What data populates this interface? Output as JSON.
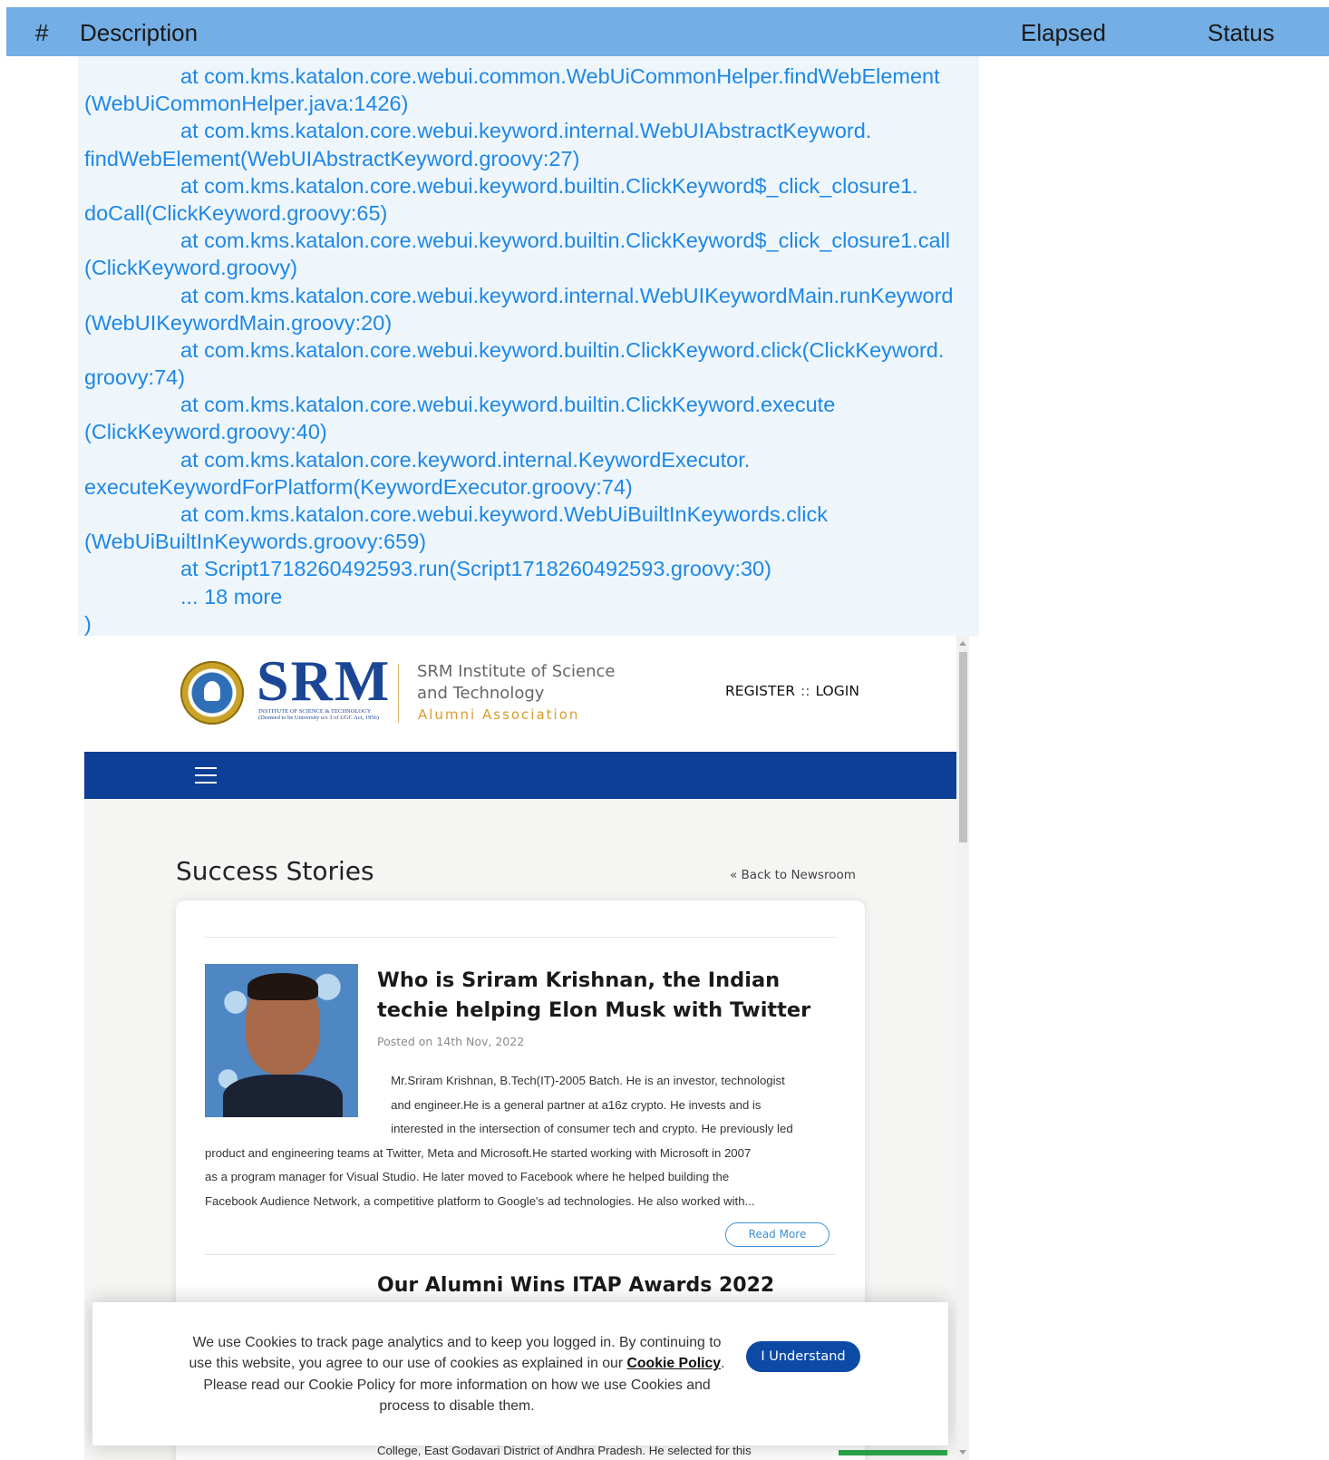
{
  "report": {
    "columns": {
      "num": "#",
      "description": "Description",
      "elapsed": "Elapsed",
      "status": "Status"
    },
    "header_color": "#73aee4",
    "log_text_color": "#1e87e6"
  },
  "log": {
    "lines": [
      {
        "indent": true,
        "text": "at com.kms.katalon.core.webui.common.WebUiCommonHelper.findWebElement"
      },
      {
        "indent": false,
        "text": "(WebUiCommonHelper.java:1426)"
      },
      {
        "indent": true,
        "text": "at com.kms.katalon.core.webui.keyword.internal.WebUIAbstractKeyword."
      },
      {
        "indent": false,
        "text": "findWebElement(WebUIAbstractKeyword.groovy:27)"
      },
      {
        "indent": true,
        "text": "at com.kms.katalon.core.webui.keyword.builtin.ClickKeyword$_click_closure1."
      },
      {
        "indent": false,
        "text": "doCall(ClickKeyword.groovy:65)"
      },
      {
        "indent": true,
        "text": "at com.kms.katalon.core.webui.keyword.builtin.ClickKeyword$_click_closure1.call"
      },
      {
        "indent": false,
        "text": "(ClickKeyword.groovy)"
      },
      {
        "indent": true,
        "text": "at com.kms.katalon.core.webui.keyword.internal.WebUIKeywordMain.runKeyword"
      },
      {
        "indent": false,
        "text": "(WebUIKeywordMain.groovy:20)"
      },
      {
        "indent": true,
        "text": "at com.kms.katalon.core.webui.keyword.builtin.ClickKeyword.click(ClickKeyword."
      },
      {
        "indent": false,
        "text": "groovy:74)"
      },
      {
        "indent": true,
        "text": "at com.kms.katalon.core.webui.keyword.builtin.ClickKeyword.execute"
      },
      {
        "indent": false,
        "text": "(ClickKeyword.groovy:40)"
      },
      {
        "indent": true,
        "text": "at com.kms.katalon.core.keyword.internal.KeywordExecutor."
      },
      {
        "indent": false,
        "text": "executeKeywordForPlatform(KeywordExecutor.groovy:74)"
      },
      {
        "indent": true,
        "text": "at com.kms.katalon.core.webui.keyword.WebUiBuiltInKeywords.click"
      },
      {
        "indent": false,
        "text": "(WebUiBuiltInKeywords.groovy:659)"
      },
      {
        "indent": true,
        "text": "at Script1718260492593.run(Script1718260492593.groovy:30)"
      },
      {
        "indent": true,
        "text": "... 18 more"
      },
      {
        "indent": false,
        "text": ")"
      }
    ]
  },
  "site": {
    "logo_text": "SRM",
    "logo_subtext": "INSTITUTE OF SCIENCE & TECHNOLOGY (Deemed to be University u/s 3 of UGC Act, 1956)",
    "institute_name": "SRM Institute of Science and Technology",
    "alumni_label": "Alumni Association",
    "register": "REGISTER",
    "separator": "::",
    "login": "LOGIN",
    "nav_color": "#0e3f96",
    "page_title": "Success Stories",
    "back_link": "« Back to Newsroom",
    "story": {
      "title": "Who is Sriram Krishnan, the Indian techie helping Elon Musk with Twitter",
      "posted": "Posted on 14th Nov, 2022",
      "excerpt_lines": [
        "                                                        Mr.Sriram Krishnan, B.Tech(IT)-2005 Batch. He is an investor, technologist",
        "                                                        and engineer.He is a general partner at a16z crypto. He invests and is",
        "                                                        interested in the intersection of consumer tech and crypto. He previously led",
        "product and engineering teams at Twitter, Meta and Microsoft.He started working with Microsoft in 2007",
        "as a program manager for Visual Studio. He later moved to Facebook where he helped building the",
        "Facebook Audience Network, a competitive platform to Google's ad technologies. He also worked with..."
      ],
      "read_more": "Read More"
    },
    "next_story_title_partial": "Our Alumni Wins ITAP Awards 2022",
    "bottom_text": "College, East Godavari District of Andhra Pradesh. He selected for this",
    "cookie": {
      "text_before": "We use Cookies to track page analytics and to keep you logged in. By continuing to use this website, you agree to our use of cookies as explained in our ",
      "policy_link": "Cookie Policy",
      "text_after": ". Please read our Cookie Policy for more information on how we use Cookies and process to disable them.",
      "button": "I Understand",
      "button_color": "#0c4aa6"
    }
  }
}
